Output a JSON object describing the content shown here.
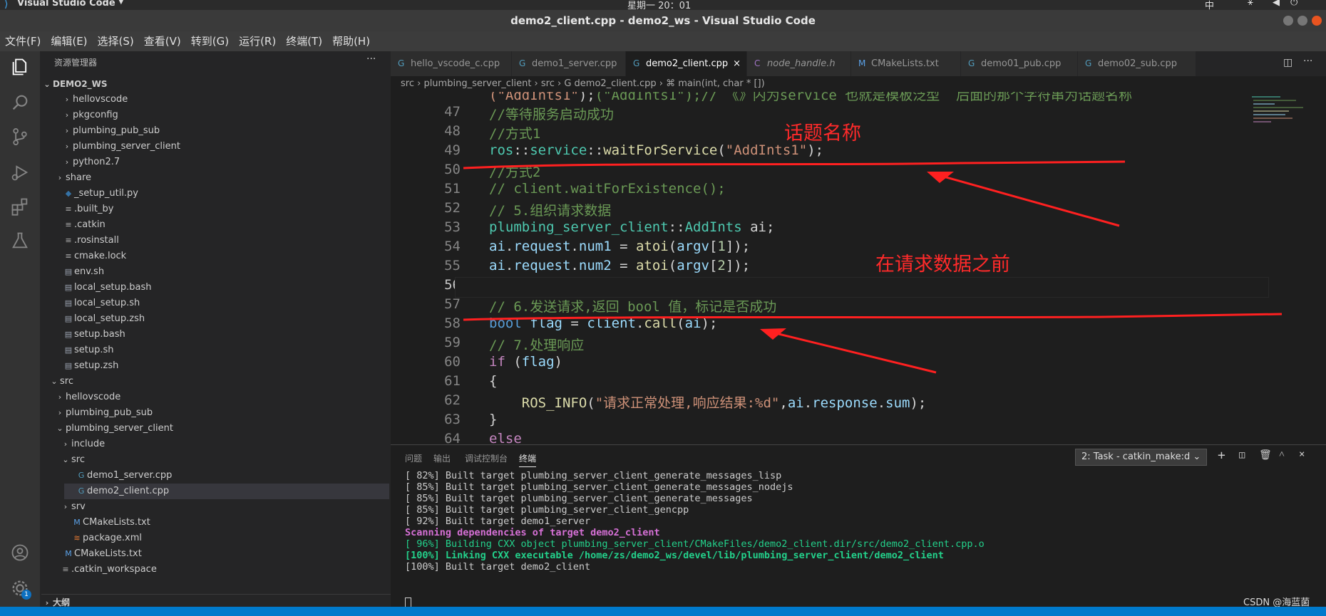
{
  "os_bar": {
    "app_name": "Visual Studio Code",
    "clock": "星期一 20：01",
    "input_method": "中"
  },
  "window": {
    "title": "demo2_client.cpp - demo2_ws - Visual Studio Code"
  },
  "menu": [
    "文件(F)",
    "编辑(E)",
    "选择(S)",
    "查看(V)",
    "转到(G)",
    "运行(R)",
    "终端(T)",
    "帮助(H)"
  ],
  "sidebar": {
    "title": "资源管理器",
    "more": "···",
    "workspace": "DEMO2_WS",
    "items": [
      {
        "label": "hellovscode",
        "chev": "›",
        "icon": ""
      },
      {
        "label": "pkgconfig",
        "chev": "›",
        "icon": ""
      },
      {
        "label": "plumbing_pub_sub",
        "chev": "›",
        "icon": ""
      },
      {
        "label": "plumbing_server_client",
        "chev": "›",
        "icon": ""
      },
      {
        "label": "python2.7",
        "chev": "›",
        "icon": ""
      },
      {
        "label": "share",
        "chev": "›",
        "icon": ""
      },
      {
        "label": "_setup_util.py",
        "chev": "",
        "icon": "◆"
      },
      {
        "label": ".built_by",
        "chev": "",
        "icon": "≡"
      },
      {
        "label": ".catkin",
        "chev": "",
        "icon": "≡"
      },
      {
        "label": ".rosinstall",
        "chev": "",
        "icon": "≡"
      },
      {
        "label": "cmake.lock",
        "chev": "",
        "icon": "≡"
      },
      {
        "label": "env.sh",
        "chev": "",
        "icon": "▤"
      },
      {
        "label": "local_setup.bash",
        "chev": "",
        "icon": "▤"
      },
      {
        "label": "local_setup.sh",
        "chev": "",
        "icon": "▤"
      },
      {
        "label": "local_setup.zsh",
        "chev": "",
        "icon": "▤"
      },
      {
        "label": "setup.bash",
        "chev": "",
        "icon": "▤"
      },
      {
        "label": "setup.sh",
        "chev": "",
        "icon": "▤"
      },
      {
        "label": "setup.zsh",
        "chev": "",
        "icon": "▤"
      },
      {
        "label": "src",
        "chev": "⌄",
        "icon": ""
      },
      {
        "label": "hellovscode",
        "chev": "›",
        "icon": ""
      },
      {
        "label": "plumbing_pub_sub",
        "chev": "›",
        "icon": ""
      },
      {
        "label": "plumbing_server_client",
        "chev": "⌄",
        "icon": ""
      },
      {
        "label": "include",
        "chev": "›",
        "icon": ""
      },
      {
        "label": "src",
        "chev": "⌄",
        "icon": ""
      },
      {
        "label": "demo1_server.cpp",
        "chev": "",
        "icon": "G"
      },
      {
        "label": "demo2_client.cpp",
        "chev": "",
        "icon": "G"
      },
      {
        "label": "srv",
        "chev": "›",
        "icon": ""
      },
      {
        "label": "CMakeLists.txt",
        "chev": "",
        "icon": "M"
      },
      {
        "label": "package.xml",
        "chev": "",
        "icon": "≋"
      },
      {
        "label": "CMakeLists.txt",
        "chev": "",
        "icon": "M"
      },
      {
        "label": ".catkin_workspace",
        "chev": "",
        "icon": "≡"
      }
    ],
    "outline": "大纲",
    "account_badge": "1"
  },
  "tabs": [
    {
      "label": "hello_vscode_c.cpp",
      "icon": "G"
    },
    {
      "label": "demo1_server.cpp",
      "icon": "G"
    },
    {
      "label": "demo2_client.cpp",
      "icon": "G",
      "close": "×"
    },
    {
      "label": "node_handle.h",
      "icon": "C"
    },
    {
      "label": "CMakeLists.txt",
      "icon": "M"
    },
    {
      "label": "demo01_pub.cpp",
      "icon": "G"
    },
    {
      "label": "demo02_sub.cpp",
      "icon": "G"
    }
  ],
  "breadcrumb": "src  ›  plumbing_server_client  ›  src  ›  G demo2_client.cpp  ›  ⌘ main(int, char * [])",
  "editor": {
    "line_numbers": [
      "47",
      "48",
      "49",
      "50",
      "51",
      "52",
      "53",
      "54",
      "55",
      "56",
      "57",
      "58",
      "59",
      "60",
      "61",
      "62",
      "63",
      "64"
    ],
    "partial_top": "(\"AddInts1\");// 《》内为service 也就是模板泛型  后面的那个字符串为话题名称",
    "annotations": {
      "topic_name": "话题名称",
      "before_request": "在请求数据之前"
    }
  },
  "panel": {
    "tabs": [
      "问题",
      "输出",
      "调试控制台",
      "终端"
    ],
    "task_select": "2: Task - catkin_make:d",
    "lines": [
      {
        "text": "[ 82%] Built target plumbing_server_client_generate_messages_lisp",
        "color": "#cccccc"
      },
      {
        "text": "[ 85%] Built target plumbing_server_client_generate_messages_nodejs",
        "color": "#cccccc"
      },
      {
        "text": "[ 85%] Built target plumbing_server_client_generate_messages",
        "color": "#cccccc"
      },
      {
        "text": "[ 85%] Built target plumbing_server_client_gencpp",
        "color": "#cccccc"
      },
      {
        "text": "[ 92%] Built target demo1_server",
        "color": "#cccccc"
      },
      {
        "text": "Scanning dependencies of target demo2_client",
        "color": "#d670d6"
      },
      {
        "text": "[ 96%] Building CXX object plumbing_server_client/CMakeFiles/demo2_client.dir/src/demo2_client.cpp.o",
        "color": "#23d18b"
      },
      {
        "text": "[100%] Linking CXX executable /home/zs/demo2_ws/devel/lib/plumbing_server_client/demo2_client",
        "color": "#23d18b"
      },
      {
        "text": "[100%] Built target demo2_client",
        "color": "#cccccc"
      }
    ],
    "watermark": "CSDN @海蓝菌"
  }
}
